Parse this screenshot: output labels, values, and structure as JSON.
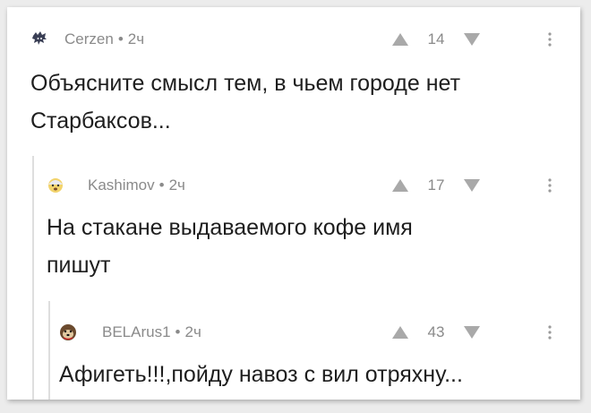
{
  "comments": [
    {
      "author": "Cerzen",
      "separator": "•",
      "time": "2ч",
      "score": "14",
      "lines": [
        "Объясните смысл тем, в чьем городе нет",
        "Старбаксов..."
      ],
      "avatar_icon": "anime-character-avatar-icon"
    },
    {
      "author": "Kashimov",
      "separator": "•",
      "time": "2ч",
      "score": "17",
      "lines": [
        "На стакане выдаваемого кофе имя",
        "пишут"
      ],
      "avatar_icon": "scared-emoji-avatar-icon"
    },
    {
      "author": "BELArus1",
      "separator": "•",
      "time": "2ч",
      "score": "43",
      "lines": [
        "Афигеть!!!,пойду навоз с вил отряхну..."
      ],
      "avatar_icon": "dog-avatar-icon"
    }
  ],
  "colors": {
    "meta_text": "#8a8a8a",
    "body_text": "#1e1e1e",
    "arrow": "#a9a9a9",
    "thread_line": "#dedede"
  }
}
